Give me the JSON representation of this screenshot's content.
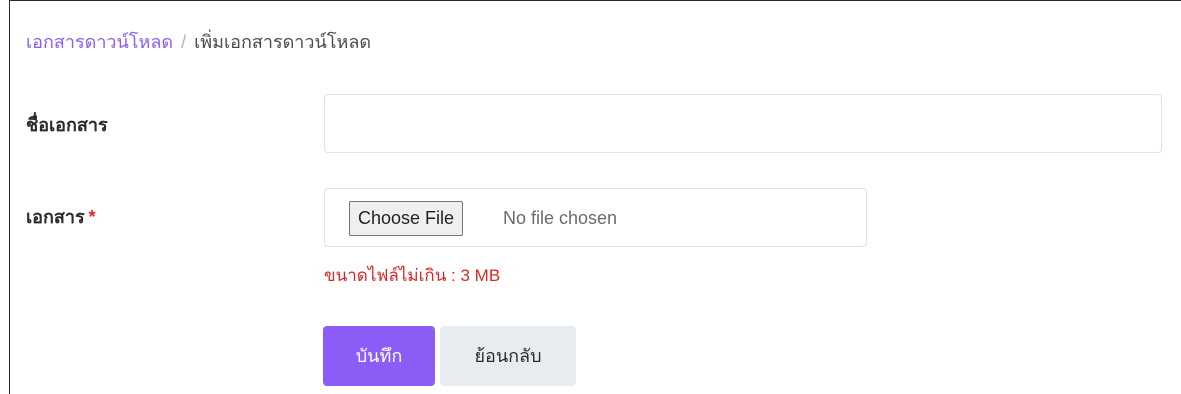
{
  "breadcrumb": {
    "parent": "เอกสารดาวน์โหลด",
    "separator": "/",
    "current": "เพิ่มเอกสารดาวน์โหลด"
  },
  "form": {
    "name_label": "ชื่อเอกสาร",
    "name_value": "",
    "file_label": "เอกสาร",
    "required_mark": "*",
    "file_button": "Choose File",
    "file_status": "No file chosen",
    "hint_label": "ขนาดไฟล์ไม่เกิน",
    "hint_value": " : 3 MB"
  },
  "actions": {
    "save": "บันทึก",
    "back": "ย้อนกลับ"
  },
  "colors": {
    "accent": "#8b5cf6",
    "danger": "#dc2626",
    "secondary_button": "#e9ecef"
  }
}
